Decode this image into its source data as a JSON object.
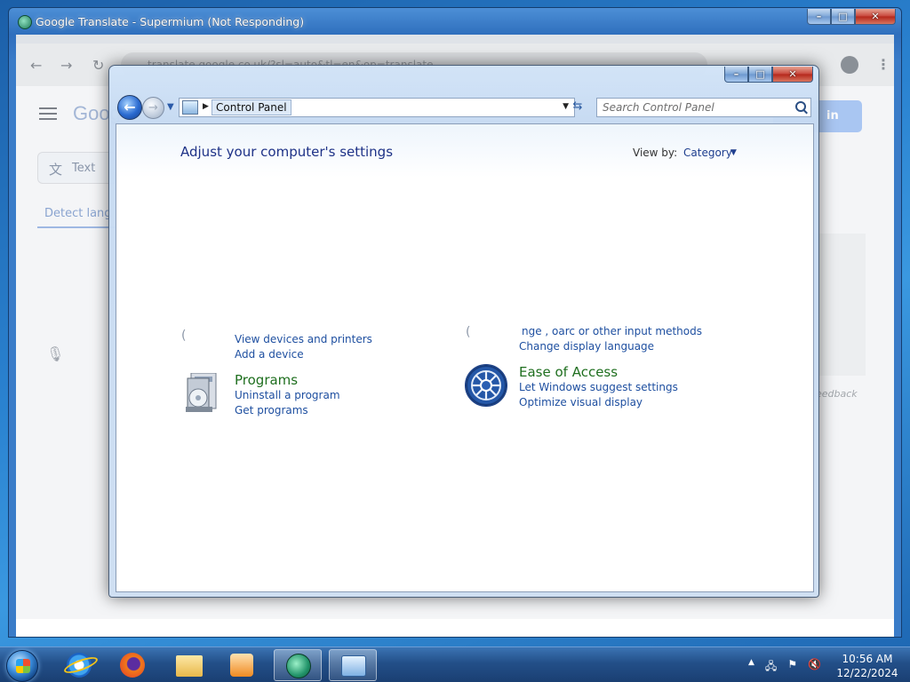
{
  "browser": {
    "title": "Google Translate - Supermium (Not Responding)",
    "url": "translate.google.co.uk/?sl=auto&tl=en&op=translate",
    "logo": "Goog",
    "text_tab": "Text",
    "detect_language": "Detect lang",
    "sign_in": "in",
    "feedback": "eedback"
  },
  "control_panel": {
    "breadcrumb": "Control Panel",
    "search_placeholder": "Search Control Panel",
    "heading": "Adjust your computer's settings",
    "view_by_label": "View by:",
    "view_by_value": "Category",
    "hardware_links": [
      "View devices and printers",
      "Add a device"
    ],
    "clock_lang_partial": "nge    ,  oarc  or other input methods",
    "clock_lang_link": "Change display language",
    "programs": {
      "title": "Programs",
      "links": [
        "Uninstall a program",
        "Get programs"
      ]
    },
    "ease_of_access": {
      "title": "Ease of Access",
      "links": [
        "Let Windows suggest settings",
        "Optimize visual display"
      ]
    }
  },
  "taskbar": {
    "time": "10:56 AM",
    "date": "12/22/2024"
  }
}
